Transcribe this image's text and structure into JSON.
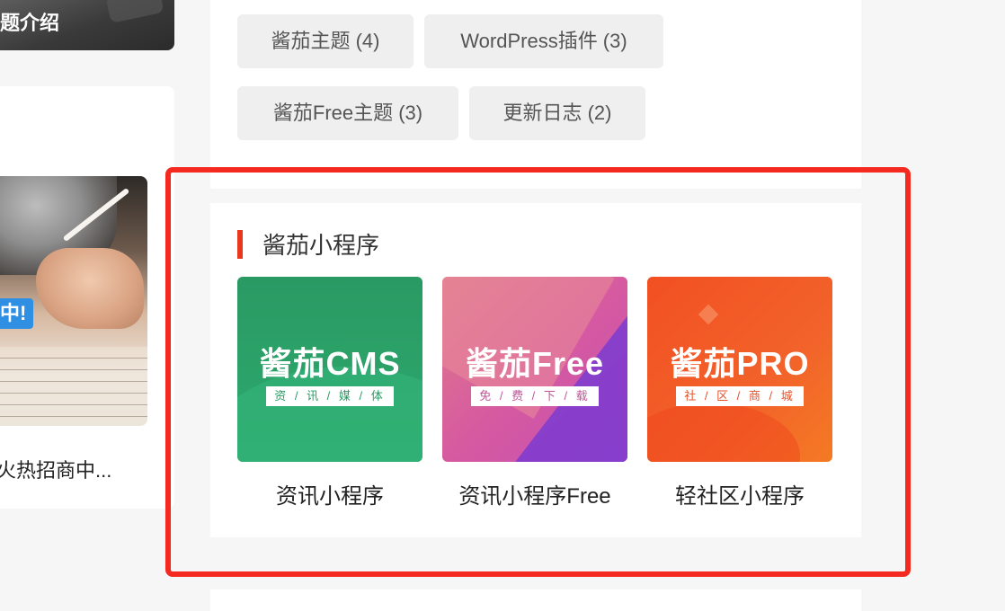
{
  "left": {
    "banner_caption": "题介绍",
    "card": {
      "thumb_tag": "中!",
      "title": "火热招商中..."
    }
  },
  "tags": [
    {
      "label": "酱茄主题 (4)"
    },
    {
      "label": "WordPress插件 (3)"
    },
    {
      "label": "酱茄Free主题 (3)"
    },
    {
      "label": "更新日志 (2)"
    }
  ],
  "widget": {
    "title": "酱茄小程序",
    "accent_color": "#e8391d",
    "apps": [
      {
        "tile_name": "酱茄CMS",
        "tile_sub": "资 / 讯 / 媒 / 体",
        "label": "资讯小程序",
        "color": "#2a9a63"
      },
      {
        "tile_name": "酱茄Free",
        "tile_sub": "免 / 费 / 下 / 载",
        "label": "资讯小程序Free",
        "color": "#d65aa0"
      },
      {
        "tile_name": "酱茄PRO",
        "tile_sub": "社 / 区 / 商 / 城",
        "label": "轻社区小程序",
        "color": "#f25022"
      }
    ]
  },
  "highlight_color": "#f42a20"
}
